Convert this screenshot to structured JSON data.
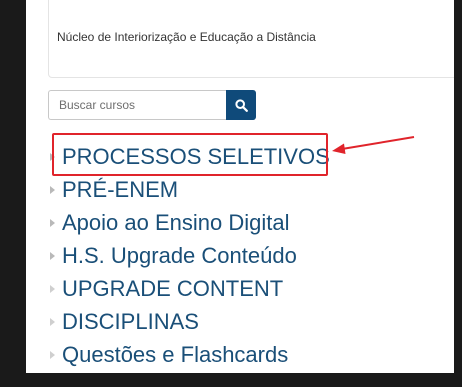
{
  "description": {
    "text": "Núcleo de Interiorização e Educação a Distância"
  },
  "search": {
    "placeholder": "Buscar cursos",
    "button_icon": "search-icon"
  },
  "categories": [
    {
      "label": "PROCESSOS SELETIVOS"
    },
    {
      "label": "PRÉ-ENEM"
    },
    {
      "label": "Apoio ao Ensino Digital"
    },
    {
      "label": "H.S. Upgrade Conteúdo"
    },
    {
      "label": "UPGRADE CONTENT"
    },
    {
      "label": "DISCIPLINAS"
    },
    {
      "label": "Questões e Flashcards"
    }
  ],
  "colors": {
    "link": "#1a4f78",
    "search_button": "#0f4a7a",
    "annotation": "#e0242b"
  }
}
